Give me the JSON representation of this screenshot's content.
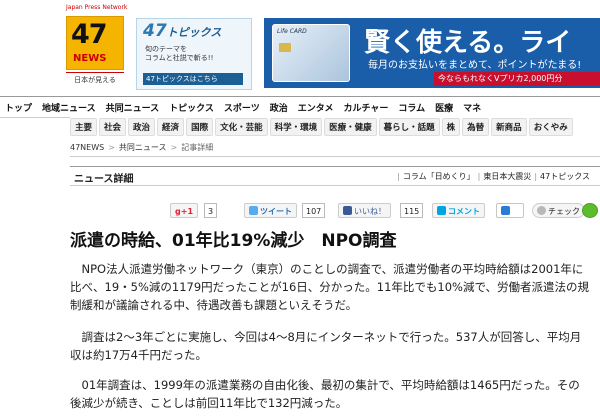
{
  "header": {
    "japan_press_network": "Japan Press Network",
    "logo_number": "47",
    "logo_word": "NEWS",
    "logo_tagline": "日本が見える",
    "topics_logo_num": "47",
    "topics_logo_word": "トピックス",
    "topics_tagline_1": "旬のテーマを",
    "topics_tagline_2": "コラムと社説で斬る!!",
    "topics_button": "47トピックスはこちら",
    "ad_card_label": "Life CARD",
    "ad_headline": "賢く使える。ライ",
    "ad_sub": "毎月のお支払いをまとめて、ポイントがたまる!",
    "ad_promo": "今ならもれなくVプリカ2,000円分"
  },
  "nav_main": [
    "トップ",
    "地域ニュース",
    "共同ニュース",
    "トピックス",
    "スポーツ",
    "政治",
    "エンタメ",
    "カルチャー",
    "コラム",
    "医療",
    "マネ"
  ],
  "nav_sub": [
    "主要",
    "社会",
    "政治",
    "経済",
    "国際",
    "文化・芸能",
    "科学・環境",
    "医療・健康",
    "暮らし・話題",
    "株",
    "為替",
    "新商品",
    "おくやみ"
  ],
  "breadcrumb": {
    "home": "47NEWS",
    "sep1": ">",
    "section": "共同ニュース",
    "sep2": ">",
    "current": "記事詳細"
  },
  "section": {
    "title": "ニュース詳細",
    "links": [
      "コラム「日めくり」",
      "東日本大震災",
      "47トピックス"
    ]
  },
  "share": {
    "gplus_label": "+1",
    "gplus_count": "3",
    "tweet_label": "ツイート",
    "tweet_count": "107",
    "like_label": "いいね！",
    "like_count": "115",
    "comment_label": "コメント",
    "check_label": "チェック"
  },
  "article": {
    "headline": "派遣の時給、01年比19%減少　NPO調査",
    "paragraphs": [
      "　NPO法人派遣労働ネットワーク（東京）のことしの調査で、派遣労働者の平均時給額は2001年に比べ、19・5%減の1179円だったことが16日、分かった。11年比でも10%減で、労働者派遣法の規制緩和が議論される中、待遇改善も課題といえそうだ。",
      "　調査は2～3年ごとに実施し、今回は4～8月にインターネットで行った。537人が回答し、平均月収は約17万4千円だった。",
      "　01年調査は、1999年の派遣業務の自由化後、最初の集計で、平均時給額は1465円だった。その後減少が続き、ことしは前回11年比で132円減った。"
    ]
  },
  "colors": {
    "logo_yellow": "#f4b400",
    "ad_blue": "#1a5da8",
    "promo_red": "#c8102e",
    "twitter_blue": "#2a6db0",
    "facebook_blue": "#3b5998"
  }
}
